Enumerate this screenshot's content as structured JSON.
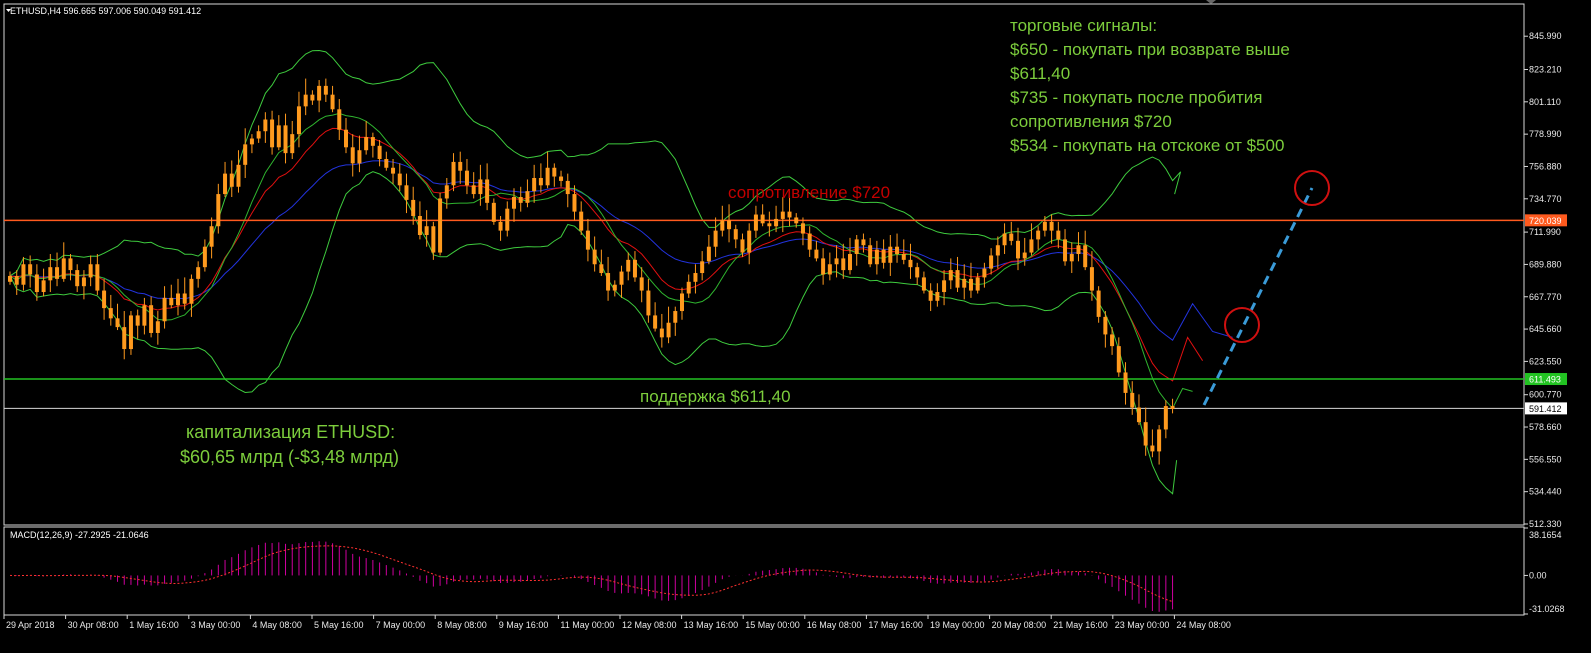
{
  "window": {
    "header": "ETHUSD,H4  596.665 597.006 590.049 591.412",
    "macd_header": "MACD(12,26,9) -27.2925 -21.0646"
  },
  "colors": {
    "background": "#000000",
    "candle": "#ff9a1e",
    "resistance_line": "#ff5a1e",
    "support_line": "#22c322",
    "current_price_line": "#d8d8d8",
    "bollinger": "#3ecb3e",
    "ma_green": "#2fb52f",
    "ma_red": "#e01010",
    "ma_blue": "#2233dd",
    "macd_hist": "#d000a0",
    "macd_signal": "#ff3030",
    "arrow": "#3a9bd8",
    "circle": "#d01010"
  },
  "annotations": {
    "signals": [
      "торговые сигналы:",
      "$650 - покупать при возврате выше",
      "$611,40",
      "$735 - покупать после пробития",
      "сопротивления $720",
      "$534 - покупать на отскоке от $500"
    ],
    "resistance_label": "сопротивление $720",
    "support_label": "поддержка $611,40",
    "capitalization": [
      "капитализация ETHUSD:",
      "$60,65 млрд (-$3,48 млрд)"
    ]
  },
  "chart_data": {
    "type": "candlestick",
    "symbol": "ETHUSD",
    "timeframe": "H4",
    "ohlc_header": {
      "open": 596.665,
      "high": 597.006,
      "low": 590.049,
      "close": 591.412
    },
    "ylim": [
      512.33,
      867.33
    ],
    "y_ticks": [
      "845.990",
      "823.210",
      "801.110",
      "778.990",
      "756.880",
      "734.770",
      "711.990",
      "689.880",
      "667.770",
      "645.660",
      "623.550",
      "600.770",
      "578.660",
      "556.550",
      "534.440",
      "512.330"
    ],
    "x_ticks": [
      "29 Apr 2018",
      "30 Apr 08:00",
      "1 May 16:00",
      "3 May 00:00",
      "4 May 08:00",
      "5 May 16:00",
      "7 May 00:00",
      "8 May 08:00",
      "9 May 16:00",
      "11 May 00:00",
      "12 May 08:00",
      "13 May 16:00",
      "15 May 00:00",
      "16 May 08:00",
      "17 May 16:00",
      "19 May 00:00",
      "20 May 08:00",
      "21 May 16:00",
      "23 May 00:00",
      "24 May 08:00"
    ],
    "levels": [
      {
        "name": "resistance",
        "value": 720.039,
        "label": "720.039"
      },
      {
        "name": "support",
        "value": 611.493,
        "label": "611.493"
      },
      {
        "name": "current",
        "value": 591.412,
        "label": "591.412"
      }
    ],
    "close": [
      682,
      676,
      690,
      683,
      671,
      679,
      688,
      680,
      694,
      686,
      675,
      681,
      690,
      672,
      660,
      653,
      647,
      632,
      655,
      648,
      662,
      643,
      651,
      667,
      662,
      670,
      663,
      680,
      688,
      702,
      716,
      738,
      752,
      743,
      758,
      772,
      776,
      781,
      789,
      770,
      785,
      766,
      779,
      798,
      806,
      802,
      812,
      806,
      796,
      782,
      770,
      759,
      768,
      777,
      771,
      762,
      756,
      752,
      744,
      734,
      723,
      710,
      716,
      698,
      735,
      744,
      760,
      754,
      744,
      738,
      748,
      732,
      719,
      713,
      728,
      736,
      732,
      740,
      749,
      744,
      756,
      750,
      747,
      738,
      726,
      713,
      700,
      690,
      684,
      672,
      676,
      685,
      693,
      681,
      672,
      655,
      646,
      640,
      650,
      658,
      670,
      678,
      684,
      692,
      702,
      713,
      720,
      714,
      707,
      698,
      713,
      724,
      718,
      716,
      721,
      726,
      722,
      718,
      711,
      700,
      694,
      683,
      690,
      694,
      686,
      697,
      707,
      703,
      690,
      700,
      691,
      702,
      697,
      693,
      688,
      681,
      672,
      665,
      671,
      679,
      686,
      674,
      680,
      672,
      681,
      687,
      696,
      703,
      711,
      706,
      694,
      698,
      707,
      713,
      719,
      713,
      707,
      692,
      697,
      703,
      688,
      672,
      654,
      642,
      634,
      616,
      602,
      592,
      582,
      566,
      562,
      577,
      593,
      591
    ],
    "macd": {
      "ylim": [
        -31.0268,
        38.1654
      ],
      "y_ticks": [
        "38.1654",
        "0.00",
        "-31.0268"
      ],
      "macd_value": -27.2925,
      "signal_value": -21.0646
    }
  }
}
